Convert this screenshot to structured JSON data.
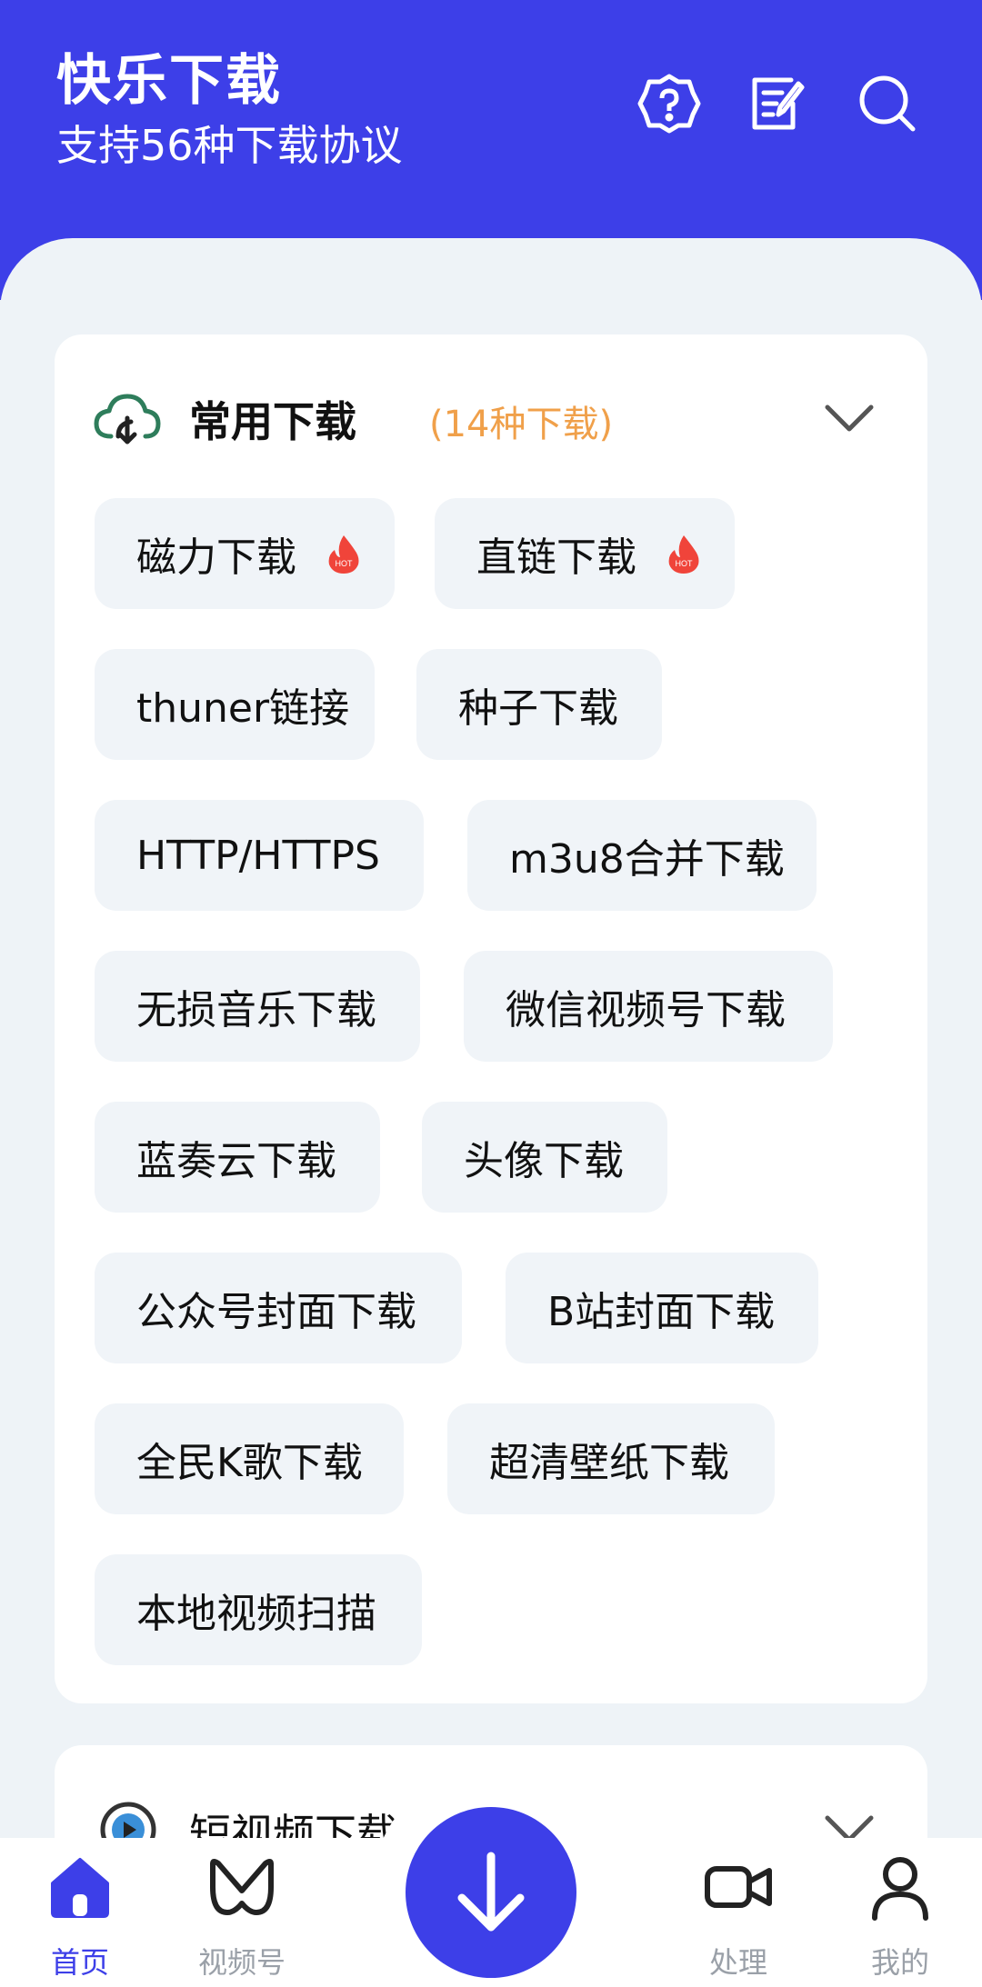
{
  "header": {
    "title": "快乐下载",
    "subtitle": "支持56种下载协议",
    "icons": [
      "settings-icon",
      "edit-note-icon",
      "search-icon"
    ]
  },
  "common_card": {
    "title": "常用下载",
    "count": "(14种下载)",
    "hot_label": "HOT",
    "tags": [
      {
        "label": "磁力下载",
        "hot": true
      },
      {
        "label": "直链下载",
        "hot": true
      },
      {
        "label": "thuner链接",
        "hot": false
      },
      {
        "label": "种子下载",
        "hot": false
      },
      {
        "label": "HTTP/HTTPS",
        "hot": false
      },
      {
        "label": "m3u8合并下载",
        "hot": false
      },
      {
        "label": "无损音乐下载",
        "hot": false
      },
      {
        "label": "微信视频号下载",
        "hot": false
      },
      {
        "label": "蓝奏云下载",
        "hot": false
      },
      {
        "label": "头像下载",
        "hot": false
      },
      {
        "label": "公众号封面下载",
        "hot": false
      },
      {
        "label": "B站封面下载",
        "hot": false
      },
      {
        "label": "全民K歌下载",
        "hot": false
      },
      {
        "label": "超清壁纸下载",
        "hot": false
      },
      {
        "label": "本地视频扫描",
        "hot": false
      }
    ]
  },
  "short_video_card": {
    "title": "短视频下载",
    "count": ")"
  },
  "tabbar": {
    "items": [
      {
        "label": "首页",
        "active": true
      },
      {
        "label": "视频号",
        "active": false
      },
      {
        "label": "处理",
        "active": false
      },
      {
        "label": "我的",
        "active": false
      }
    ]
  },
  "colors": {
    "brand": "#3d3fe8",
    "accent_orange": "#f0a04a",
    "hot_red": "#f0443a",
    "tag_bg": "#f0f4f8"
  }
}
